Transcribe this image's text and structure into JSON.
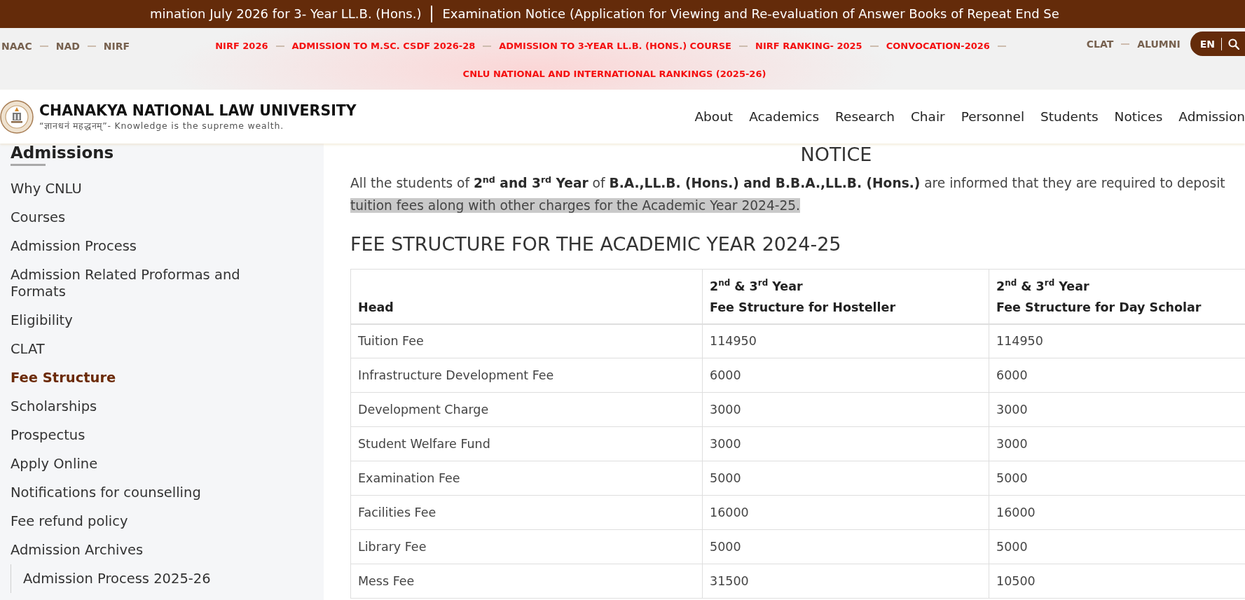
{
  "ticker": {
    "items": [
      "mination July 2026 for 3- Year LL.B. (Hons.)",
      "Examination Notice (Application for Viewing and Re-evaluation of Answer Books of Repeat End Se"
    ]
  },
  "top_bar": {
    "left_links": [
      "NAAC",
      "NAD",
      "NIRF"
    ],
    "announcements": [
      "NIRF 2026",
      "ADMISSION TO M.SC. CSDF 2026-28",
      "ADMISSION TO 3-YEAR LL.B. (HONS.) COURSE",
      "NIRF RANKING- 2025",
      "CONVOCATION-2026",
      "CNLU NATIONAL AND INTERNATIONAL RANKINGS (2025-26)"
    ],
    "right_links": [
      "CLAT",
      "ALUMNI"
    ],
    "language": "EN"
  },
  "header": {
    "title": "CHANAKYA NATIONAL LAW UNIVERSITY",
    "motto": "“ज्ञानधनं महद्धनम्”- Knowledge is the supreme wealth.",
    "nav": [
      "About",
      "Academics",
      "Research",
      "Chair",
      "Personnel",
      "Students",
      "Notices",
      "Admission"
    ]
  },
  "sidebar": {
    "title": "Admissions",
    "items": [
      {
        "label": "Why CNLU",
        "selected": false
      },
      {
        "label": "Courses",
        "selected": false
      },
      {
        "label": "Admission Process",
        "selected": false
      },
      {
        "label": "Admission Related Proformas and Formats",
        "selected": false
      },
      {
        "label": "Eligibility",
        "selected": false
      },
      {
        "label": "CLAT",
        "selected": false
      },
      {
        "label": "Fee Structure",
        "selected": true
      },
      {
        "label": "Scholarships",
        "selected": false
      },
      {
        "label": "Prospectus",
        "selected": false
      },
      {
        "label": "Apply Online",
        "selected": false
      },
      {
        "label": "Notifications for counselling",
        "selected": false
      },
      {
        "label": "Fee refund policy",
        "selected": false
      },
      {
        "label": "Admission Archives",
        "selected": false,
        "children": [
          {
            "label": "Admission Process 2025-26",
            "selected": false
          }
        ]
      }
    ]
  },
  "notice": {
    "title": "NOTICE",
    "text": "All the students of **2$^{nd}$ and 3$^{rd}$ Year** of **B.A.,LL.B. (Hons.) and B.B.A.,LL.B. (Hons.)** are informed that they are required to deposit",
    "selected_text": "tuition fees along with other charges for the Academic Year 2024-25."
  },
  "fee_table": {
    "title": "FEE STRUCTURE FOR THE ACADEMIC YEAR 2024-25",
    "columns": [
      {
        "lines": [
          "Head"
        ]
      },
      {
        "lines": [
          "2$^{nd}$ & 3$^{rd}$ Year",
          "Fee Structure for Hosteller"
        ]
      },
      {
        "lines": [
          "2$^{nd}$ & 3$^{rd}$ Year",
          "Fee Structure for Day Scholar"
        ]
      }
    ],
    "rows": [
      [
        "Tuition Fee",
        "114950",
        "114950"
      ],
      [
        "Infrastructure Development Fee",
        "6000",
        "6000"
      ],
      [
        "Development Charge",
        "3000",
        "3000"
      ],
      [
        "Student Welfare Fund",
        "3000",
        "3000"
      ],
      [
        "Examination Fee",
        "5000",
        "5000"
      ],
      [
        "Facilities Fee",
        "16000",
        "16000"
      ],
      [
        "Library Fee",
        "5000",
        "5000"
      ],
      [
        "Mess Fee",
        "31500",
        "10500"
      ]
    ]
  }
}
